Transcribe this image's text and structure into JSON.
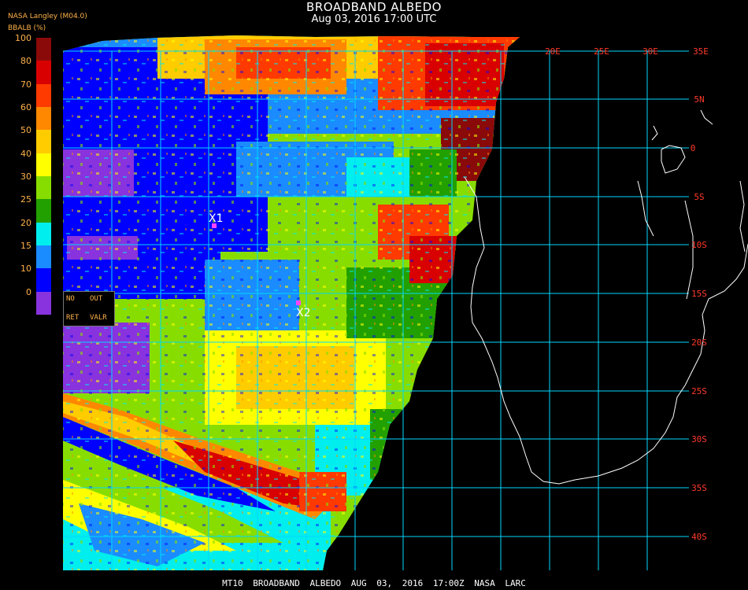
{
  "header": {
    "title": "BROADBAND ALBEDO",
    "datetime": "Aug 03, 2016 17:00 UTC",
    "source": "NASA Langley (M04.0)",
    "product": "BBALB (%)"
  },
  "colorbar": {
    "labels": [
      "100",
      "80",
      "70",
      "60",
      "50",
      "40",
      "30",
      "25",
      "20",
      "15",
      "10",
      "0"
    ],
    "colors": [
      "#8a0a0a",
      "#d80000",
      "#ff3a00",
      "#ff8800",
      "#ffcc00",
      "#ffff00",
      "#88dd00",
      "#22a000",
      "#00eeee",
      "#1a8cff",
      "#0000ff",
      "#8833dd"
    ]
  },
  "legend_box": {
    "no": "NO",
    "out": "OUT",
    "ret": "RET",
    "valr": "VALR"
  },
  "lon_labels": [
    "20E",
    "25E",
    "30E",
    "35E"
  ],
  "lat_labels": [
    "5N",
    "0",
    "5S",
    "10S",
    "15S",
    "20S",
    "25S",
    "30S",
    "35S",
    "40S"
  ],
  "markers": [
    {
      "label": "X1"
    },
    {
      "label": "X2"
    }
  ],
  "footer": "MT10  BROADBAND ALBEDO   AUG 03, 2016 17:00Z   NASA LARC"
}
